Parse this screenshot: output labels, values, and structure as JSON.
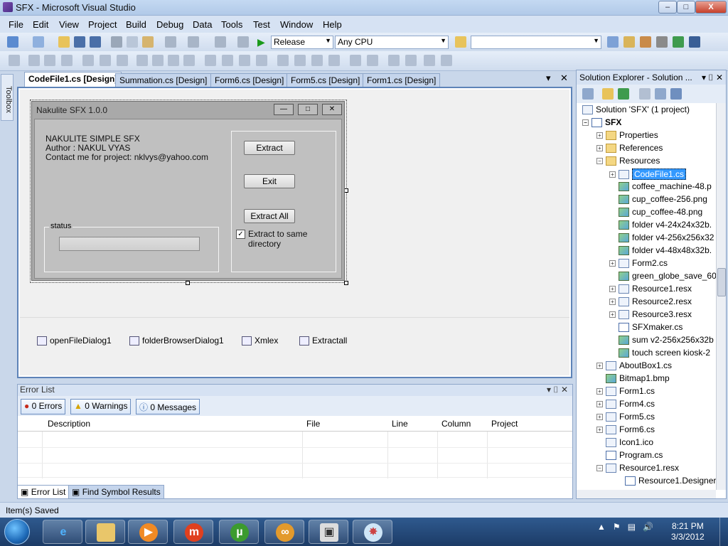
{
  "window": {
    "title": "SFX - Microsoft Visual Studio",
    "min_label": "–",
    "max_label": "□",
    "close_label": "X"
  },
  "menu": [
    "File",
    "Edit",
    "View",
    "Project",
    "Build",
    "Debug",
    "Data",
    "Tools",
    "Test",
    "Window",
    "Help"
  ],
  "toolbar": {
    "config": "Release",
    "platform": "Any CPU",
    "find_value": ""
  },
  "toolbox_label": "Toolbox",
  "doc_tabs": [
    "CodeFile1.cs [Design]",
    "Summation.cs [Design]",
    "Form6.cs [Design]",
    "Form5.cs [Design]",
    "Form1.cs [Design]"
  ],
  "doc_controls": {
    "dropdown": "▾",
    "close": "✕"
  },
  "form": {
    "title": "Nakulite SFX 1.0.0",
    "min_label": "—",
    "max_label": "□",
    "close_label": "✕",
    "line1": "NAKULITE SIMPLE SFX",
    "line2": "Author : NAKUL VYAS",
    "line3": "Contact me for project: nklvys@yahoo.com",
    "status_group": "status",
    "btn_extract": "Extract",
    "btn_exit": "Exit",
    "btn_extract_all": "Extract All",
    "checkbox_label": "Extract to same directory",
    "checkbox_mark": "✓"
  },
  "tray_components": [
    "openFileDialog1",
    "folderBrowserDialog1",
    "Xmlex",
    "Extractall"
  ],
  "error_list": {
    "title": "Error List",
    "errors": "0 Errors",
    "warnings": "0 Warnings",
    "messages": "0 Messages",
    "columns": [
      "Description",
      "File",
      "Line",
      "Column",
      "Project"
    ],
    "controls": "▾ ⌷ ✕"
  },
  "bottom_tabs": [
    "Error List",
    "Find Symbol Results"
  ],
  "solution_explorer": {
    "title": "Solution Explorer - Solution ...",
    "controls": "▾ ⌷ ✕",
    "root": "Solution 'SFX' (1 project)",
    "project": "SFX",
    "items": [
      {
        "label": "Properties",
        "icon": "folder-icon"
      },
      {
        "label": "References",
        "icon": "references-icon"
      },
      {
        "label": "Resources",
        "icon": "folder-open-icon"
      },
      {
        "label": "CodeFile1.cs",
        "icon": "form-icon"
      },
      {
        "label": "coffee_machine-48.p",
        "icon": "image-icon"
      },
      {
        "label": "cup_coffee-256.png",
        "icon": "image-icon"
      },
      {
        "label": "cup_coffee-48.png",
        "icon": "image-icon"
      },
      {
        "label": "folder v4-24x24x32b.",
        "icon": "image-icon"
      },
      {
        "label": "folder v4-256x256x32",
        "icon": "image-icon"
      },
      {
        "label": "folder v4-48x48x32b.",
        "icon": "image-icon"
      },
      {
        "label": "Form2.cs",
        "icon": "form-icon"
      },
      {
        "label": "green_globe_save_60",
        "icon": "image-icon"
      },
      {
        "label": "Resource1.resx",
        "icon": "resx-icon"
      },
      {
        "label": "Resource2.resx",
        "icon": "resx-icon"
      },
      {
        "label": "Resource3.resx",
        "icon": "resx-icon"
      },
      {
        "label": "SFXmaker.cs",
        "icon": "cs-file-icon"
      },
      {
        "label": "sum v2-256x256x32b",
        "icon": "image-icon"
      },
      {
        "label": "touch screen kiosk-2",
        "icon": "image-icon"
      },
      {
        "label": "AboutBox1.cs",
        "icon": "form-icon"
      },
      {
        "label": "Bitmap1.bmp",
        "icon": "bitmap-icon"
      },
      {
        "label": "Form1.cs",
        "icon": "form-icon"
      },
      {
        "label": "Form4.cs",
        "icon": "form-icon"
      },
      {
        "label": "Form5.cs",
        "icon": "form-icon"
      },
      {
        "label": "Form6.cs",
        "icon": "form-icon"
      },
      {
        "label": "Icon1.ico",
        "icon": "icon-file-icon"
      },
      {
        "label": "Program.cs",
        "icon": "cs-file-icon"
      },
      {
        "label": "Resource1.resx",
        "icon": "resx-icon"
      },
      {
        "label": "Resource1.Designer.",
        "icon": "cs-file-icon"
      }
    ]
  },
  "status_bar": "Item(s) Saved",
  "taskbar": {
    "apps": [
      "internet-explorer-icon",
      "file-explorer-icon",
      "media-player-icon",
      "m-app-icon",
      "utorrent-icon",
      "visual-studio-icon",
      "app-window-icon",
      "paint-icon"
    ],
    "time": "8:21 PM",
    "date": "3/3/2012"
  },
  "colors": {
    "accent": "#3399ff",
    "frame": "#5d83b8",
    "taskbar": "#1c3b66"
  }
}
